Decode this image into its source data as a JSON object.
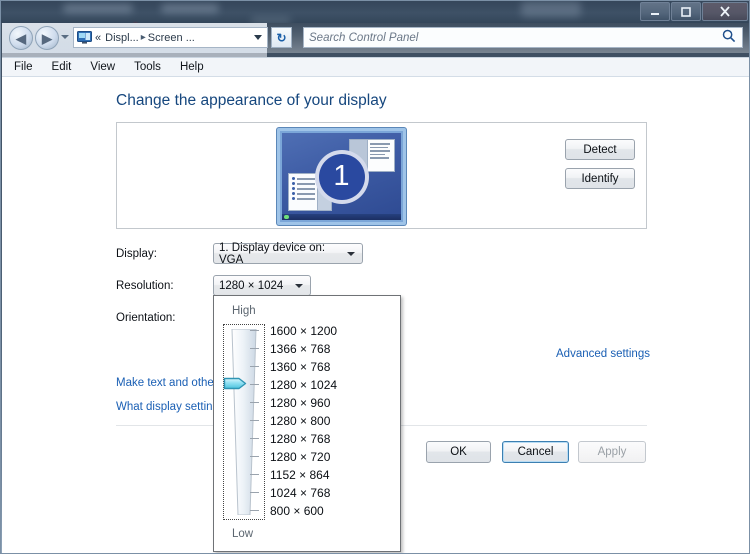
{
  "window": {
    "title": "Screen Resolution",
    "controls": {
      "minimize": "minimize-icon",
      "maximize": "maximize-icon",
      "close": "close-icon"
    }
  },
  "nav": {
    "back_glyph": "◀",
    "forward_glyph": "▶",
    "breadcrumb": {
      "icon": "display-icon",
      "overflow": "«",
      "segments": [
        "Displ...",
        "Screen ..."
      ],
      "separator": "▸"
    },
    "refresh_glyph": "↻"
  },
  "search": {
    "placeholder": "Search Control Panel",
    "value": "",
    "icon": "search-icon"
  },
  "menubar": {
    "items": [
      {
        "label": "File"
      },
      {
        "label": "Edit"
      },
      {
        "label": "View"
      },
      {
        "label": "Tools"
      },
      {
        "label": "Help"
      }
    ]
  },
  "main": {
    "heading": "Change the appearance of your display",
    "preview": {
      "monitor_number": "1",
      "detect_label": "Detect",
      "identify_label": "Identify"
    },
    "fields": {
      "display_label": "Display:",
      "display_value": "1. Display device on: VGA",
      "resolution_label": "Resolution:",
      "resolution_value": "1280 × 1024",
      "orientation_label": "Orientation:"
    },
    "links": {
      "make_text": "Make text and other",
      "what_display": "What display setting",
      "advanced": "Advanced settings"
    },
    "buttons": {
      "ok": "OK",
      "cancel": "Cancel",
      "apply": "Apply"
    }
  },
  "resolution_popup": {
    "high_label": "High",
    "low_label": "Low",
    "selected_index": 3,
    "items": [
      "1600 × 1200",
      "1366 × 768",
      "1360 × 768",
      "1280 × 1024",
      "1280 × 960",
      "1280 × 800",
      "1280 × 768",
      "1280 × 720",
      "1152 × 864",
      "1024 × 768",
      "800 × 600"
    ]
  },
  "colors": {
    "heading_blue": "#16477e",
    "link_blue": "#1a5fb4",
    "monitor_blue": "#2a49a0",
    "slider_thumb": "#8fe0f0",
    "titlebar": "#3e5166"
  }
}
